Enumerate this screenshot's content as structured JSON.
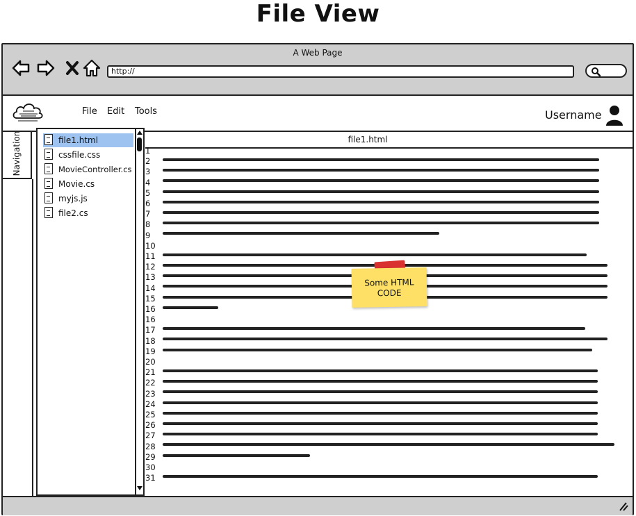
{
  "page": {
    "heading": "File View"
  },
  "browser": {
    "title": "A Web Page",
    "url": "http://"
  },
  "app": {
    "menu": [
      "File",
      "Edit",
      "Tools"
    ],
    "username": "Username",
    "logo_icon": "cloud-icon",
    "user_icon": "user-icon"
  },
  "navigation": {
    "label": "Navigation"
  },
  "file_tree": {
    "selected": "file1.html",
    "files": [
      "file1.html",
      "cssfile.css",
      "MovieController.cs",
      "Movie.cs",
      "myjs.js",
      "file2.cs"
    ]
  },
  "editor": {
    "tab_label": "file1.html",
    "line_numbers": [
      "1",
      "2",
      "3",
      "4",
      "5",
      "6",
      "7",
      "8",
      "9",
      "10",
      "11",
      "12",
      "13",
      "14",
      "15",
      "16",
      "16",
      "17",
      "18",
      "19",
      "20",
      "21",
      "22",
      "23",
      "24",
      "25",
      "26",
      "27",
      "28",
      "29",
      "30",
      "31"
    ],
    "sticky_note": {
      "line1": "Some HTML",
      "line2": "CODE"
    }
  }
}
